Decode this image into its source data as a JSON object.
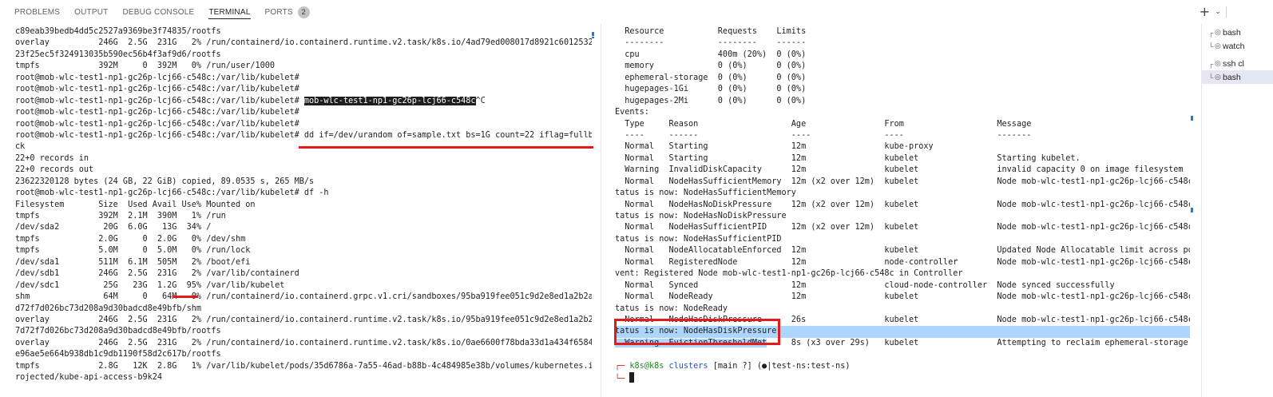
{
  "tabs": [
    {
      "label": "PROBLEMS"
    },
    {
      "label": "OUTPUT"
    },
    {
      "label": "DEBUG CONSOLE"
    },
    {
      "label": "TERMINAL"
    },
    {
      "label": "PORTS",
      "badge": "2"
    }
  ],
  "left_terminal": [
    "c89eab39bedb4dd5c2527a9369be3f74835/rootfs",
    "overlay          246G  2.5G  231G   2% /run/containerd/io.containerd.runtime.v2.task/k8s.io/4ad79ed008017d8921c60125329e2",
    "23f25ec5f324913035b590ec56b4f3af9d6/rootfs",
    "tmpfs            392M     0  392M   0% /run/user/1000",
    "root@mob-wlc-test1-np1-gc26p-lcj66-c548c:/var/lib/kubelet#",
    "root@mob-wlc-test1-np1-gc26p-lcj66-c548c:/var/lib/kubelet#",
    "root@mob-wlc-test1-np1-gc26p-lcj66-c548c:/var/lib/kubelet# mob-wlc-test1-np1-gc26p-lcj66-c548c^C",
    "root@mob-wlc-test1-np1-gc26p-lcj66-c548c:/var/lib/kubelet#",
    "root@mob-wlc-test1-np1-gc26p-lcj66-c548c:/var/lib/kubelet#",
    "root@mob-wlc-test1-np1-gc26p-lcj66-c548c:/var/lib/kubelet# dd if=/dev/urandom of=sample.txt bs=1G count=22 iflag=fullblo",
    "ck",
    "22+0 records in",
    "22+0 records out",
    "23622320128 bytes (24 GB, 22 GiB) copied, 89.0535 s, 265 MB/s",
    "root@mob-wlc-test1-np1-gc26p-lcj66-c548c:/var/lib/kubelet# df -h",
    "Filesystem       Size  Used Avail Use% Mounted on",
    "tmpfs            392M  2.1M  390M   1% /run",
    "/dev/sda2         20G  6.0G   13G  34% /",
    "tmpfs            2.0G     0  2.0G   0% /dev/shm",
    "tmpfs            5.0M     0  5.0M   0% /run/lock",
    "/dev/sda1        511M  6.1M  505M   2% /boot/efi",
    "/dev/sdb1        246G  2.5G  231G   2% /var/lib/containerd",
    "/dev/sdc1         25G   23G  1.2G  95% /var/lib/kubelet",
    "shm               64M     0   64M   0% /run/containerd/io.containerd.grpc.v1.cri/sandboxes/95ba919fee051c9d2e8ed1a2b2a0a7",
    "d72f7d026bc73d208a9d30badcd8e49bfb/shm",
    "overlay          246G  2.5G  231G   2% /run/containerd/io.containerd.runtime.v2.task/k8s.io/95ba919fee051c9d2e8ed1a2b2a0a",
    "7d72f7d026bc73d208a9d30badcd8e49bfb/rootfs",
    "overlay          246G  2.5G  231G   2% /run/containerd/io.containerd.runtime.v2.task/k8s.io/0ae6600f78bda33d1a434f6584fb7",
    "e96ae5e664b938db1c9db1190f58d2c617b/rootfs",
    "tmpfs            2.8G   12K  2.8G   1% /var/lib/kubelet/pods/35d6786a-7a55-46ad-b88b-4c484985e38b/volumes/kubernetes.io~p",
    "rojected/kube-api-access-b9k24"
  ],
  "right_terminal": [
    "  Resource           Requests    Limits",
    "  --------           --------    ------",
    "  cpu                400m (20%)  0 (0%)",
    "  memory             0 (0%)      0 (0%)",
    "  ephemeral-storage  0 (0%)      0 (0%)",
    "  hugepages-1Gi      0 (0%)      0 (0%)",
    "  hugepages-2Mi      0 (0%)      0 (0%)",
    "Events:",
    "  Type     Reason                   Age                From                   Message",
    "  ----     ------                   ----               ----                   -------",
    "  Normal   Starting                 12m                kube-proxy",
    "  Normal   Starting                 12m                kubelet                Starting kubelet.",
    "  Warning  InvalidDiskCapacity      12m                kubelet                invalid capacity 0 on image filesystem",
    "  Normal   NodeHasSufficientMemory  12m (x2 over 12m)  kubelet                Node mob-wlc-test1-np1-gc26p-lcj66-c548c s",
    "tatus is now: NodeHasSufficientMemory",
    "  Normal   NodeHasNoDiskPressure    12m (x2 over 12m)  kubelet                Node mob-wlc-test1-np1-gc26p-lcj66-c548c s",
    "tatus is now: NodeHasNoDiskPressure",
    "  Normal   NodeHasSufficientPID     12m (x2 over 12m)  kubelet                Node mob-wlc-test1-np1-gc26p-lcj66-c548c s",
    "tatus is now: NodeHasSufficientPID",
    "  Normal   NodeAllocatableEnforced  12m                kubelet                Updated Node Allocatable limit across pods",
    "  Normal   RegisteredNode           12m                node-controller        Node mob-wlc-test1-np1-gc26p-lcj66-c548c e",
    "vent: Registered Node mob-wlc-test1-np1-gc26p-lcj66-c548c in Controller",
    "  Normal   Synced                   12m                cloud-node-controller  Node synced successfully",
    "  Normal   NodeReady                12m                kubelet                Node mob-wlc-test1-np1-gc26p-lcj66-c548c s",
    "tatus is now: NodeReady",
    "  Normal   NodeHasDiskPressure      26s                kubelet                Node mob-wlc-test1-np1-gc26p-lcj66-c548c s",
    "tatus is now: NodeHasDiskPressure",
    "  Warning  EvictionThresholdMet     8s (x3 over 29s)   kubelet                Attempting to reclaim ephemeral-storage"
  ],
  "prompt": {
    "user": "k8s@k8s",
    "dir": "clusters",
    "git": "[main ?]",
    "context": "(●|test-ns:test-ns)"
  },
  "sidebar": [
    {
      "label": "bash"
    },
    {
      "label": "watch"
    },
    {
      "label": "ssh cl"
    },
    {
      "label": "bash"
    }
  ]
}
